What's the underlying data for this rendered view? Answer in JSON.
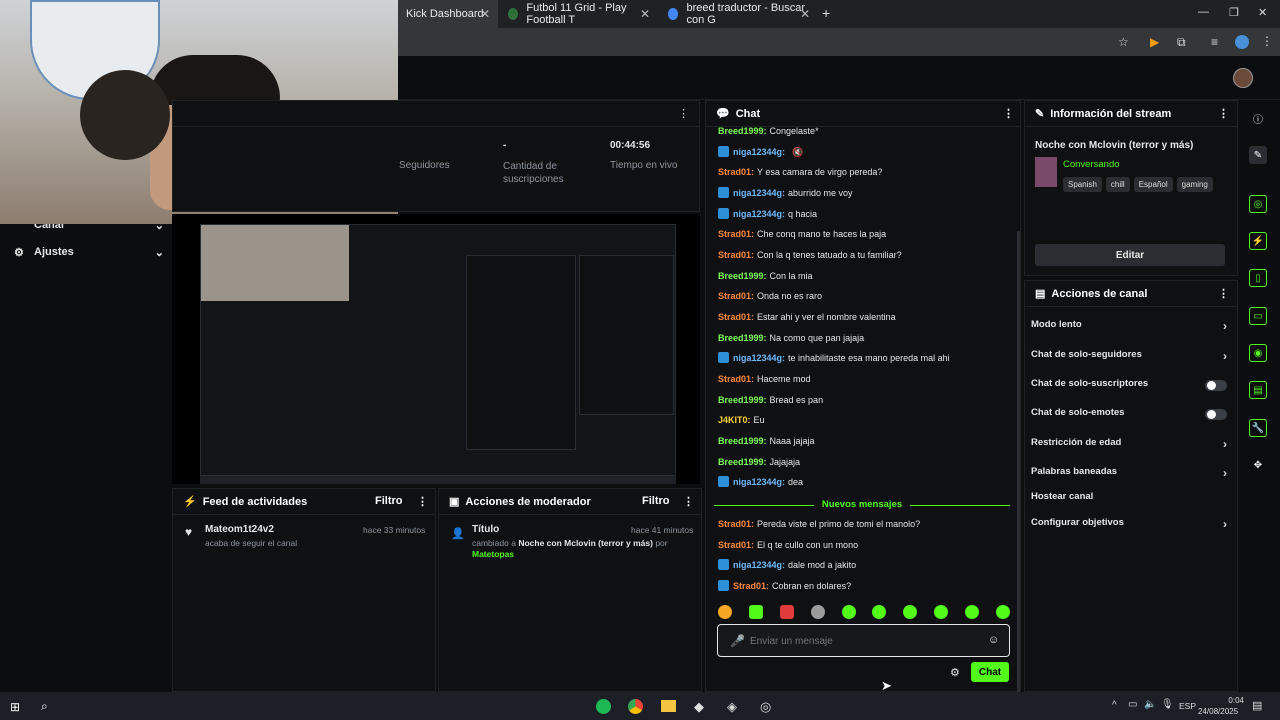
{
  "browser": {
    "tabs": [
      {
        "label": "Kick Dashboard"
      },
      {
        "label": "Futbol 11 Grid - Play Football T"
      },
      {
        "label": "breed traductor - Buscar con G"
      }
    ],
    "new_tab": "+"
  },
  "sidebar": {
    "items": [
      {
        "label": "Canal"
      },
      {
        "label": "Ajustes"
      }
    ]
  },
  "stats": {
    "followers_label": "Seguidores",
    "subs_value": "-",
    "subs_label": "Cantidad de suscripciones",
    "live_time_value": "00:44:56",
    "live_time_label": "Tiempo en vivo"
  },
  "activity_feed": {
    "title": "Feed de actividades",
    "filter": "Filtro",
    "item": {
      "user": "Mateom1t24v2",
      "time": "hace 33 minutos",
      "text": "acaba de seguir el canal"
    }
  },
  "mod_actions": {
    "title": "Acciones de moderador",
    "filter": "Filtro",
    "item": {
      "title": "Título",
      "time": "hace 41 minutos",
      "prefix": "cambiado a",
      "value": "Noche con Mclovin (terror y más)",
      "by": "por",
      "user": "Matetopas"
    }
  },
  "chat": {
    "title": "Chat",
    "messages": [
      {
        "user": "Breed1999:",
        "text": "Congelaste*",
        "color": "green",
        "badge": false
      },
      {
        "user": "niga12344g:",
        "text": "",
        "color": "blue",
        "badge": true,
        "emote": true
      },
      {
        "user": "Strad01:",
        "text": "Y esa camara de virgo pereda?",
        "color": "orange",
        "badge": false
      },
      {
        "user": "niga12344g:",
        "text": "aburrido me voy",
        "color": "blue",
        "badge": true
      },
      {
        "user": "niga12344g:",
        "text": "q hacia",
        "color": "blue",
        "badge": true
      },
      {
        "user": "Strad01:",
        "text": "Che conq mano te haces la paja",
        "color": "orange",
        "badge": false
      },
      {
        "user": "Strad01:",
        "text": "Con la q tenes tatuado a tu familiar?",
        "color": "orange",
        "badge": false
      },
      {
        "user": "Breed1999:",
        "text": "Con la mia",
        "color": "green",
        "badge": false
      },
      {
        "user": "Strad01:",
        "text": "Onda no es raro",
        "color": "orange",
        "badge": false
      },
      {
        "user": "Strad01:",
        "text": "Estar ahi y ver el nombre valentina",
        "color": "orange",
        "badge": false
      },
      {
        "user": "Breed1999:",
        "text": "Na como que pan jajaja",
        "color": "green",
        "badge": false
      },
      {
        "user": "niga12344g:",
        "text": "te inhabilitaste esa mano pereda mal ahi",
        "color": "blue",
        "badge": true
      },
      {
        "user": "Strad01:",
        "text": "Haceme mod",
        "color": "orange",
        "badge": false
      },
      {
        "user": "Breed1999:",
        "text": "Bread es pan",
        "color": "green",
        "badge": false
      },
      {
        "user": "J4KIT0:",
        "text": "Eu",
        "color": "yellow",
        "badge": false
      },
      {
        "user": "Breed1999:",
        "text": "Naaa jajaja",
        "color": "green",
        "badge": false
      },
      {
        "user": "Breed1999:",
        "text": "Jajajaja",
        "color": "green",
        "badge": false
      },
      {
        "user": "niga12344g:",
        "text": "dea",
        "color": "blue",
        "badge": true
      }
    ],
    "new_messages_label": "Nuevos mensajes",
    "new_messages": [
      {
        "user": "Strad01:",
        "text": "Pereda viste el primo de tomi el manolo?",
        "color": "orange",
        "badge": false
      },
      {
        "user": "Strad01:",
        "text": "El q te cullo con un mono",
        "color": "orange",
        "badge": false
      },
      {
        "user": "niga12344g:",
        "text": "dale mod a jakito",
        "color": "blue",
        "badge": true
      },
      {
        "user": "Strad01:",
        "text": "Cobran en dolares?",
        "color": "orange",
        "badge": true
      }
    ],
    "input_placeholder": "Enviar un mensaje",
    "send_label": "Chat"
  },
  "stream_info": {
    "title": "Información del stream",
    "stream_title": "Noche con Mclovin (terror y más)",
    "category": "Conversando",
    "tags": [
      "Spanish",
      "chill",
      "Español",
      "gaming"
    ],
    "edit_label": "Editar"
  },
  "channel_actions": {
    "title": "Acciones de canal",
    "items": [
      {
        "label": "Modo lento",
        "control": "chevron"
      },
      {
        "label": "Chat de solo-seguidores",
        "control": "chevron"
      },
      {
        "label": "Chat de solo-suscriptores",
        "control": "toggle"
      },
      {
        "label": "Chat de solo-emotes",
        "control": "toggle"
      },
      {
        "label": "Restricción de edad",
        "control": "chevron"
      },
      {
        "label": "Palabras baneadas",
        "control": "chevron"
      },
      {
        "label": "Hostear canal",
        "control": "none"
      },
      {
        "label": "Configurar objetivos",
        "control": "chevron"
      }
    ]
  },
  "taskbar": {
    "lang": "ESP",
    "time": "0:04",
    "date": "24/08/2025"
  },
  "colors": {
    "accent": "#53fc18",
    "background": "#0b0d0f",
    "panel": "#0e1012"
  }
}
